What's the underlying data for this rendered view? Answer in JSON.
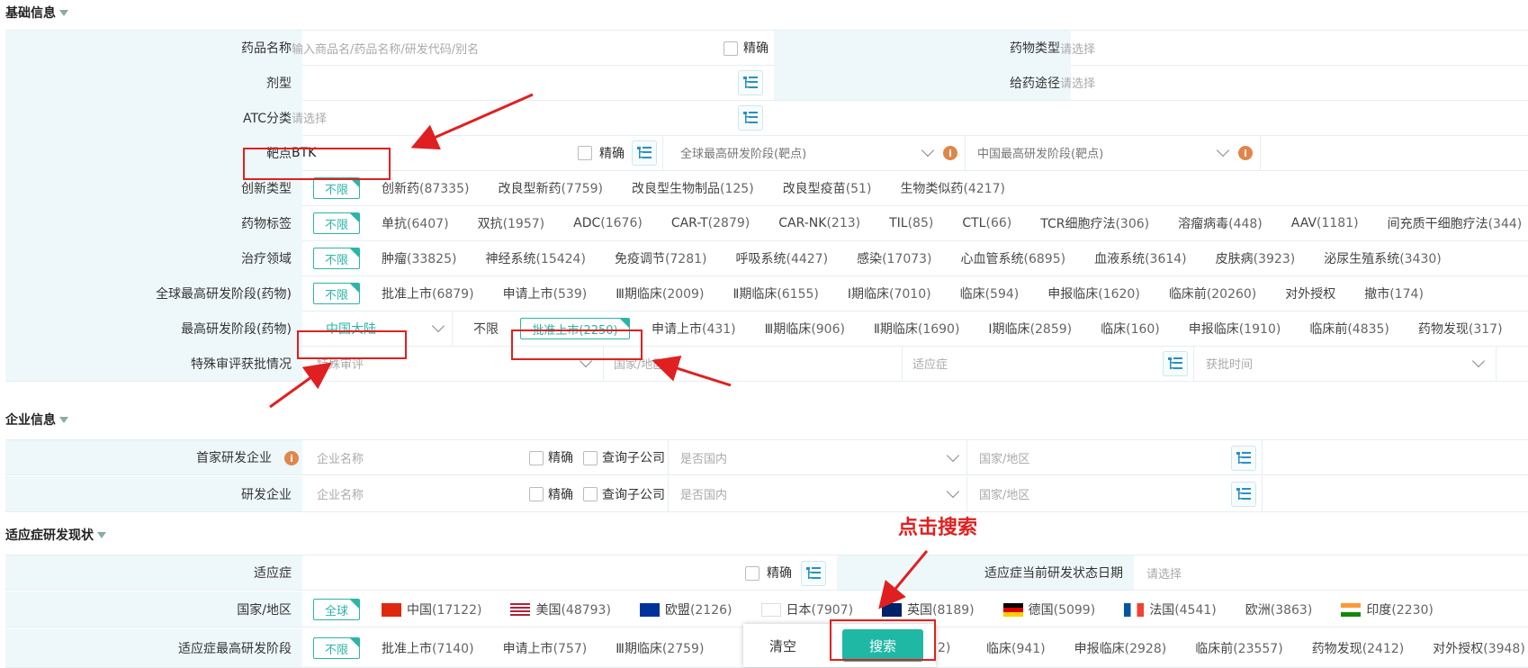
{
  "sections": {
    "basic": "基础信息",
    "company": "企业信息",
    "indication": "适应症研发现状"
  },
  "basic": {
    "drug_name": {
      "label": "药品名称",
      "placeholder": "输入商品名/药品名称/研发代码/别名",
      "exact": "精确"
    },
    "drug_type": {
      "label": "药物类型",
      "placeholder": "请选择"
    },
    "dosage": {
      "label": "剂型"
    },
    "route": {
      "label": "给药途径",
      "placeholder": "请选择"
    },
    "atc": {
      "label": "ATC分类",
      "placeholder": "请选择"
    },
    "target": {
      "label": "靶点",
      "value": "BTK",
      "exact": "精确",
      "global_stage": "全球最高研发阶段(靶点)",
      "china_stage": "中国最高研发阶段(靶点)"
    },
    "innovation": {
      "label": "创新类型",
      "unlimited": "不限",
      "options": [
        [
          "创新药",
          "(87335)"
        ],
        [
          "改良型新药",
          "(7759)"
        ],
        [
          "改良型生物制品",
          "(125)"
        ],
        [
          "改良型疫苗",
          "(51)"
        ],
        [
          "生物类似药",
          "(4217)"
        ]
      ]
    },
    "tags": {
      "label": "药物标签",
      "unlimited": "不限",
      "options": [
        [
          "单抗",
          "(6407)"
        ],
        [
          "双抗",
          "(1957)"
        ],
        [
          "ADC",
          "(1676)"
        ],
        [
          "CAR-T",
          "(2879)"
        ],
        [
          "CAR-NK",
          "(213)"
        ],
        [
          "TIL",
          "(85)"
        ],
        [
          "CTL",
          "(66)"
        ],
        [
          "TCR细胞疗法",
          "(306)"
        ],
        [
          "溶瘤病毒",
          "(448)"
        ],
        [
          "AAV",
          "(1181)"
        ],
        [
          "间充质干细胞疗法",
          "(344)"
        ]
      ]
    },
    "therapy": {
      "label": "治疗领域",
      "unlimited": "不限",
      "options": [
        [
          "肿瘤",
          "(33825)"
        ],
        [
          "神经系统",
          "(15424)"
        ],
        [
          "免疫调节",
          "(7281)"
        ],
        [
          "呼吸系统",
          "(4427)"
        ],
        [
          "感染",
          "(17073)"
        ],
        [
          "心血管系统",
          "(6895)"
        ],
        [
          "血液系统",
          "(3614)"
        ],
        [
          "皮肤病",
          "(3923)"
        ],
        [
          "泌尿生殖系统",
          "(3430)"
        ]
      ]
    },
    "global_stage": {
      "label": "全球最高研发阶段(药物)",
      "unlimited": "不限",
      "options": [
        [
          "批准上市",
          "(6879)"
        ],
        [
          "申请上市",
          "(539)"
        ],
        [
          "Ⅲ期临床",
          "(2009)"
        ],
        [
          "Ⅱ期临床",
          "(6155)"
        ],
        [
          "Ⅰ期临床",
          "(7010)"
        ],
        [
          "临床",
          "(594)"
        ],
        [
          "申报临床",
          "(1620)"
        ],
        [
          "临床前",
          "(20260)"
        ],
        [
          "对外授权",
          ""
        ],
        [
          "撤市",
          "(174)"
        ]
      ]
    },
    "max_stage": {
      "label": "最高研发阶段(药物)",
      "region": "中国大陆",
      "unlimited": "不限",
      "selected": "批准上市(2250)",
      "options": [
        [
          "申请上市",
          "(431)"
        ],
        [
          "Ⅲ期临床",
          "(906)"
        ],
        [
          "Ⅱ期临床",
          "(1690)"
        ],
        [
          "Ⅰ期临床",
          "(2859)"
        ],
        [
          "临床",
          "(160)"
        ],
        [
          "申报临床",
          "(1910)"
        ],
        [
          "临床前",
          "(4835)"
        ],
        [
          "药物发现",
          "(317)"
        ]
      ]
    },
    "special": {
      "label": "特殊审评获批情况",
      "placeholder": "特殊审评",
      "country": "国家/地区",
      "indication": "适应症",
      "time": "获批时间"
    }
  },
  "company": {
    "first": {
      "label": "首家研发企业",
      "placeholder": "企业名称",
      "exact": "精确",
      "sub": "查询子公司",
      "domestic": "是否国内",
      "country": "国家/地区"
    },
    "dev": {
      "label": "研发企业",
      "placeholder": "企业名称",
      "exact": "精确",
      "sub": "查询子公司",
      "domestic": "是否国内",
      "country": "国家/地区"
    }
  },
  "indication": {
    "ind": {
      "label": "适应症",
      "exact": "精确",
      "date_label": "适应症当前研发状态日期",
      "date_placeholder": "请选择"
    },
    "country": {
      "label": "国家/地区",
      "all": "全球",
      "options": [
        [
          "中国",
          "(17122)"
        ],
        [
          "美国",
          "(48793)"
        ],
        [
          "欧盟",
          "(2126)"
        ],
        [
          "日本",
          "(7907)"
        ],
        [
          "英国",
          "(8189)"
        ],
        [
          "德国",
          "(5099)"
        ],
        [
          "法国",
          "(4541)"
        ],
        [
          "欧洲",
          "(3863)"
        ],
        [
          "印度",
          "(2230)"
        ]
      ]
    },
    "stage": {
      "label": "适应症最高研发阶段",
      "unlimited": "不限",
      "options": [
        [
          "批准上市",
          "(7140)"
        ],
        [
          "申请上市",
          "(757)"
        ],
        [
          "Ⅲ期临床",
          "(2759)"
        ]
      ],
      "options_right": [
        [
          "临床",
          "(941)"
        ],
        [
          "申报临床",
          "(2928)"
        ],
        [
          "临床前",
          "(23557)"
        ],
        [
          "药物发现",
          "(2412)"
        ],
        [
          "对外授权",
          "(3948)"
        ]
      ],
      "partial": "2)"
    }
  },
  "popup": {
    "clear": "清空",
    "search": "搜索"
  },
  "annotation": "点击搜索",
  "colors": {
    "accent": "#1fb8a4",
    "label_bg": "#eef8fb",
    "annotation_red": "#e02020"
  }
}
